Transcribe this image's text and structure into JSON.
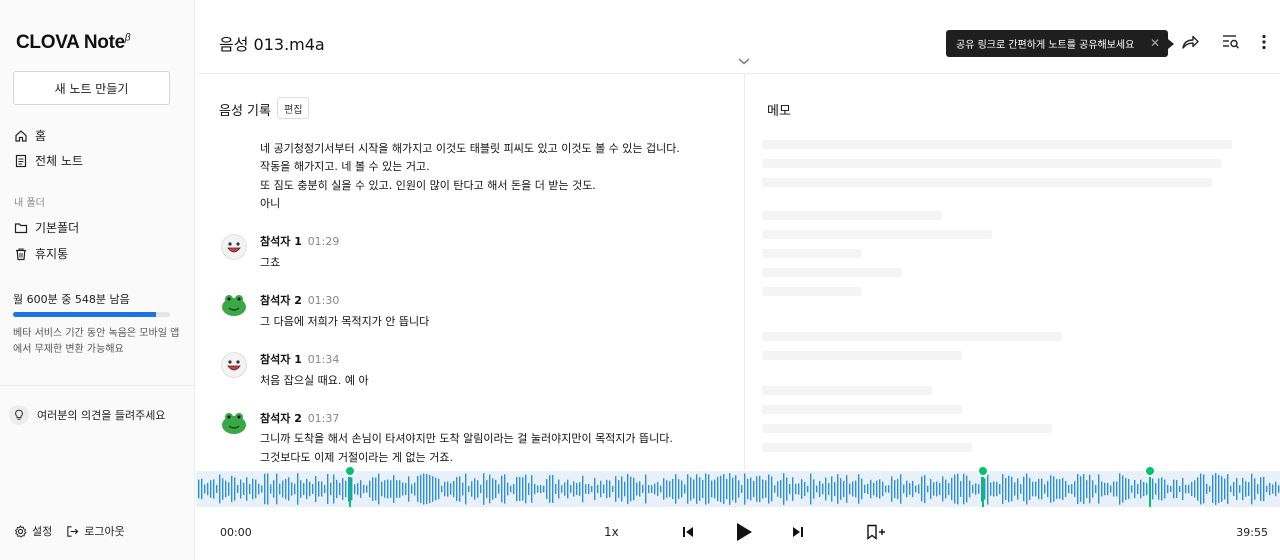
{
  "sidebar": {
    "logo_text": "CLOVA Note",
    "logo_sup": "β",
    "new_note": "새 노트 만들기",
    "nav": [
      {
        "label": "홈",
        "icon": "home-icon"
      },
      {
        "label": "전체 노트",
        "icon": "document-icon"
      }
    ],
    "folder_section": "내 폴더",
    "folders": [
      {
        "label": "기본폴더",
        "icon": "folder-icon"
      },
      {
        "label": "휴지통",
        "icon": "trash-icon"
      }
    ],
    "usage_text": "월 600분 중 548분 남음",
    "usage_fraction": 0.913,
    "usage_note": "베타 서비스 기간 동안 녹음은 모바일 앱에서 무제한 변환 가능해요",
    "feedback": "여러분의 의견을 들려주세요",
    "settings": "설정",
    "logout": "로그아웃"
  },
  "header": {
    "title": "음성 013.m4a",
    "tooltip": "공유 링크로 간편하게 노트를 공유해보세요",
    "icons": [
      "share-icon",
      "search-list-icon",
      "more-icon"
    ]
  },
  "transcript": {
    "title": "음성 기록",
    "edit": "편집",
    "top_lines": [
      "네 공기청정기서부터 시작을 해가지고 이것도 태블릿 피씨도 있고 이것도 볼 수 있는 겁니다.",
      "작동을 해가지고. 네 볼 수 있는 거고.",
      "또 짐도 충분히 실을 수 있고. 인원이 많이 탄다고 해서 돈을 더 받는 것도.",
      "아니"
    ],
    "entries": [
      {
        "speaker": "참석자 1",
        "time": "01:29",
        "avatar": "white",
        "lines": [
          "그쵸"
        ]
      },
      {
        "speaker": "참석자 2",
        "time": "01:30",
        "avatar": "green",
        "lines": [
          "그 다음에 저희가 목적지가 안 뜹니다"
        ]
      },
      {
        "speaker": "참석자 1",
        "time": "01:34",
        "avatar": "white",
        "lines": [
          "처음 잡으실 때요. 예 아"
        ]
      },
      {
        "speaker": "참석자 2",
        "time": "01:37",
        "avatar": "green",
        "lines": [
          "그니까 도착을 해서 손님이 타셔야지만 도착 알림이라는 걸 눌러야지만이 목적지가 뜹니다.",
          "그것보다도 이제 거절이라는 게 없는 거죠."
        ]
      }
    ]
  },
  "memo": {
    "title": "메모"
  },
  "player": {
    "current_time": "00:00",
    "total_time": "39:55",
    "speed": "1x",
    "markers": [
      0.141,
      0.725,
      0.879
    ]
  },
  "colors": {
    "accent": "#1a73e8",
    "marker": "#00c36e",
    "wave": "#2f8fd6"
  }
}
